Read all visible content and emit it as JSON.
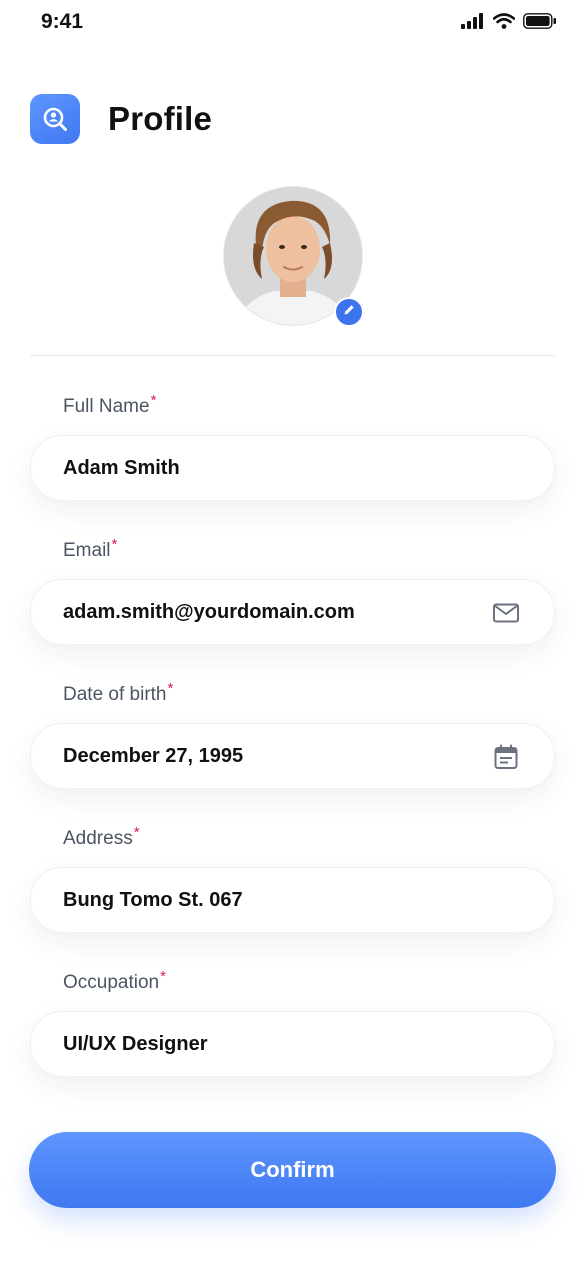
{
  "status_bar": {
    "time": "9:41",
    "icons": [
      "signal-icon",
      "wifi-icon",
      "battery-icon"
    ]
  },
  "header": {
    "title": "Profile",
    "icon": "profile-search-icon"
  },
  "avatar": {
    "edit_icon": "pencil-icon"
  },
  "form": {
    "fields": [
      {
        "label": "Full Name",
        "required_mark": "*",
        "value": "Adam Smith"
      },
      {
        "label": "Email",
        "required_mark": "*",
        "value": "adam.smith@yourdomain.com",
        "icon": "mail-icon"
      },
      {
        "label": "Date of birth",
        "required_mark": "*",
        "value": "December 27, 1995",
        "icon": "calendar-icon"
      },
      {
        "label": "Address",
        "required_mark": "*",
        "value": "Bung Tomo St. 067"
      },
      {
        "label": "Occupation",
        "required_mark": "*",
        "value": "UI/UX Designer"
      }
    ]
  },
  "confirm_button": {
    "label": "Confirm"
  },
  "colors": {
    "accent": "#4a82f5",
    "required": "#e11d48",
    "label": "#4b5563",
    "text": "#111111"
  }
}
